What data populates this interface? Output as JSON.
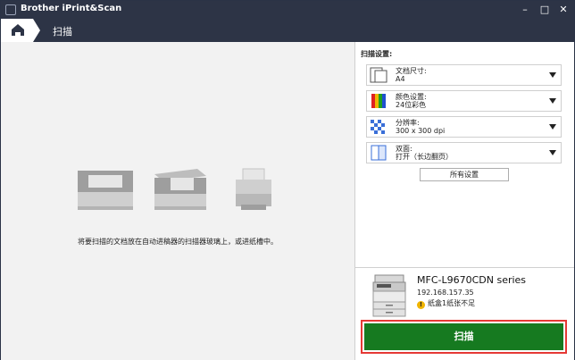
{
  "window": {
    "title": "Brother iPrint&Scan",
    "minimize": "–",
    "maximize": "□",
    "close": "✕"
  },
  "nav": {
    "home_icon": "home-icon",
    "breadcrumb": "扫描"
  },
  "main": {
    "instruction": "将要扫描的文档放在自动进稿器的扫描器玻璃上，或进纸槽中。"
  },
  "settings": {
    "heading": "扫描设置:",
    "items": [
      {
        "label": "文档尺寸:",
        "value": "A4",
        "icon": "document-size-icon"
      },
      {
        "label": "颜色设置:",
        "value": "24位彩色",
        "icon": "color-setting-icon"
      },
      {
        "label": "分辨率:",
        "value": "300 x 300 dpi",
        "icon": "resolution-icon"
      },
      {
        "label": "双面:",
        "value": "打开（长边翻页）",
        "icon": "duplex-icon"
      }
    ],
    "all_settings": "所有设置"
  },
  "device": {
    "name": "MFC-L9670CDN series",
    "ip": "192.168.157.35",
    "warning": "纸盒1纸张不足",
    "warning_icon": "warning-icon"
  },
  "actions": {
    "scan": "扫描"
  },
  "colors": {
    "titlebar": "#2d3446",
    "scan_button": "#167a20",
    "highlight": "#e53935"
  }
}
